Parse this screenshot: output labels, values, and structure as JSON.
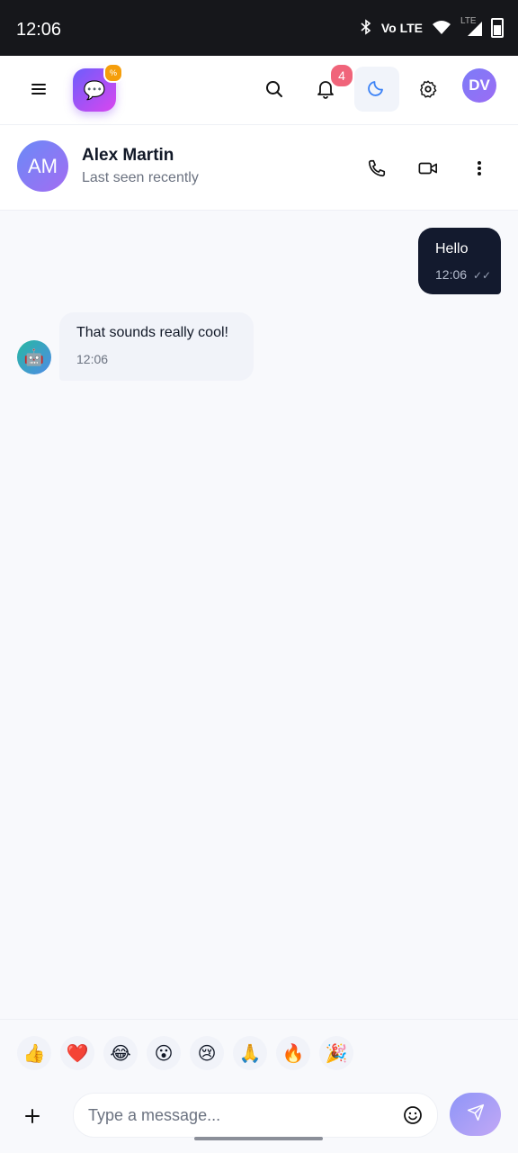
{
  "status_bar": {
    "time": "12:06",
    "icons": [
      "bluetooth-icon",
      "volte-icon",
      "wifi-icon",
      "lte-signal-icon",
      "battery-icon"
    ],
    "volte": "Vo LTE",
    "lte": "LTE"
  },
  "top_bar": {
    "logo_icon": "chat-bubble-icon",
    "logo_badge": "%",
    "notification_count": "4",
    "user_initials": "DV"
  },
  "chat_header": {
    "initials": "AM",
    "name": "Alex Martin",
    "status": "Last seen recently"
  },
  "messages": [
    {
      "direction": "out",
      "text": "Hello",
      "time": "12:06"
    },
    {
      "direction": "in",
      "text": "That sounds really cool!",
      "time": "12:06",
      "avatar": "🤖"
    }
  ],
  "quick_reactions": [
    "👍",
    "❤️",
    "😂",
    "😮",
    "😢",
    "🙏",
    "🔥",
    "🎉"
  ],
  "composer": {
    "placeholder": "Type a message...",
    "value": ""
  },
  "colors": {
    "accent_gradient_start": "#6d5dfc",
    "accent_gradient_end": "#d946ef",
    "outgoing_bubble": "#131a2e",
    "incoming_bubble": "#f1f3f9",
    "badge": "#f0647a"
  }
}
